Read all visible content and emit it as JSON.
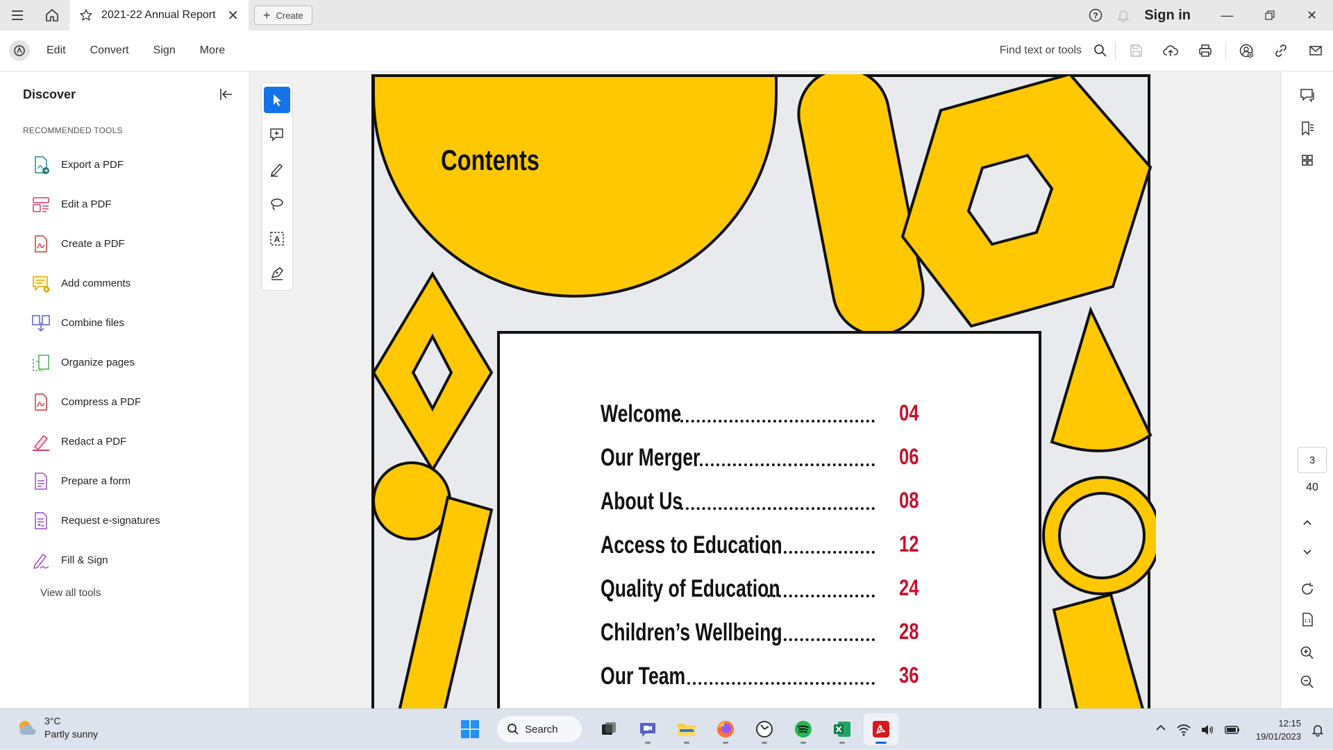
{
  "tabbar": {
    "tab_title": "2021-22 Annual Report",
    "create_label": "Create",
    "sign_in_label": "Sign in"
  },
  "toolbar": {
    "menu": [
      "Edit",
      "Convert",
      "Sign",
      "More"
    ],
    "find_label": "Find text or tools"
  },
  "left_panel": {
    "title": "Discover",
    "section_label": "RECOMMENDED TOOLS",
    "tools": [
      {
        "label": "Export a PDF",
        "icon": "export-pdf-icon"
      },
      {
        "label": "Edit a PDF",
        "icon": "edit-pdf-icon"
      },
      {
        "label": "Create a PDF",
        "icon": "create-pdf-icon"
      },
      {
        "label": "Add comments",
        "icon": "comment-icon"
      },
      {
        "label": "Combine files",
        "icon": "combine-files-icon"
      },
      {
        "label": "Organize pages",
        "icon": "organize-pages-icon"
      },
      {
        "label": "Compress a PDF",
        "icon": "compress-pdf-icon"
      },
      {
        "label": "Redact a PDF",
        "icon": "redact-icon"
      },
      {
        "label": "Prepare a form",
        "icon": "form-icon"
      },
      {
        "label": "Request e-signatures",
        "icon": "e-signature-icon"
      },
      {
        "label": "Fill & Sign",
        "icon": "fill-sign-icon"
      }
    ],
    "view_all_label": "View all tools"
  },
  "document": {
    "heading": "Contents",
    "toc": [
      {
        "title": "Welcome",
        "page": "04"
      },
      {
        "title": "Our Merger",
        "page": "06"
      },
      {
        "title": "About Us",
        "page": "08"
      },
      {
        "title": "Access to Education",
        "page": "12"
      },
      {
        "title": "Quality of Education",
        "page": "24"
      },
      {
        "title": "Children’s Wellbeing",
        "page": "28"
      },
      {
        "title": "Our Team",
        "page": "36"
      }
    ],
    "colors": {
      "accent_yellow": "#FFC800",
      "page_bg": "#E9EAEE",
      "page_number_red": "#C8102E"
    }
  },
  "right_rail": {
    "current_page": "3",
    "total_pages": "40"
  },
  "taskbar": {
    "weather_temp": "3°C",
    "weather_desc": "Partly sunny",
    "search_label": "Search",
    "time": "12:15",
    "date": "19/01/2023"
  }
}
